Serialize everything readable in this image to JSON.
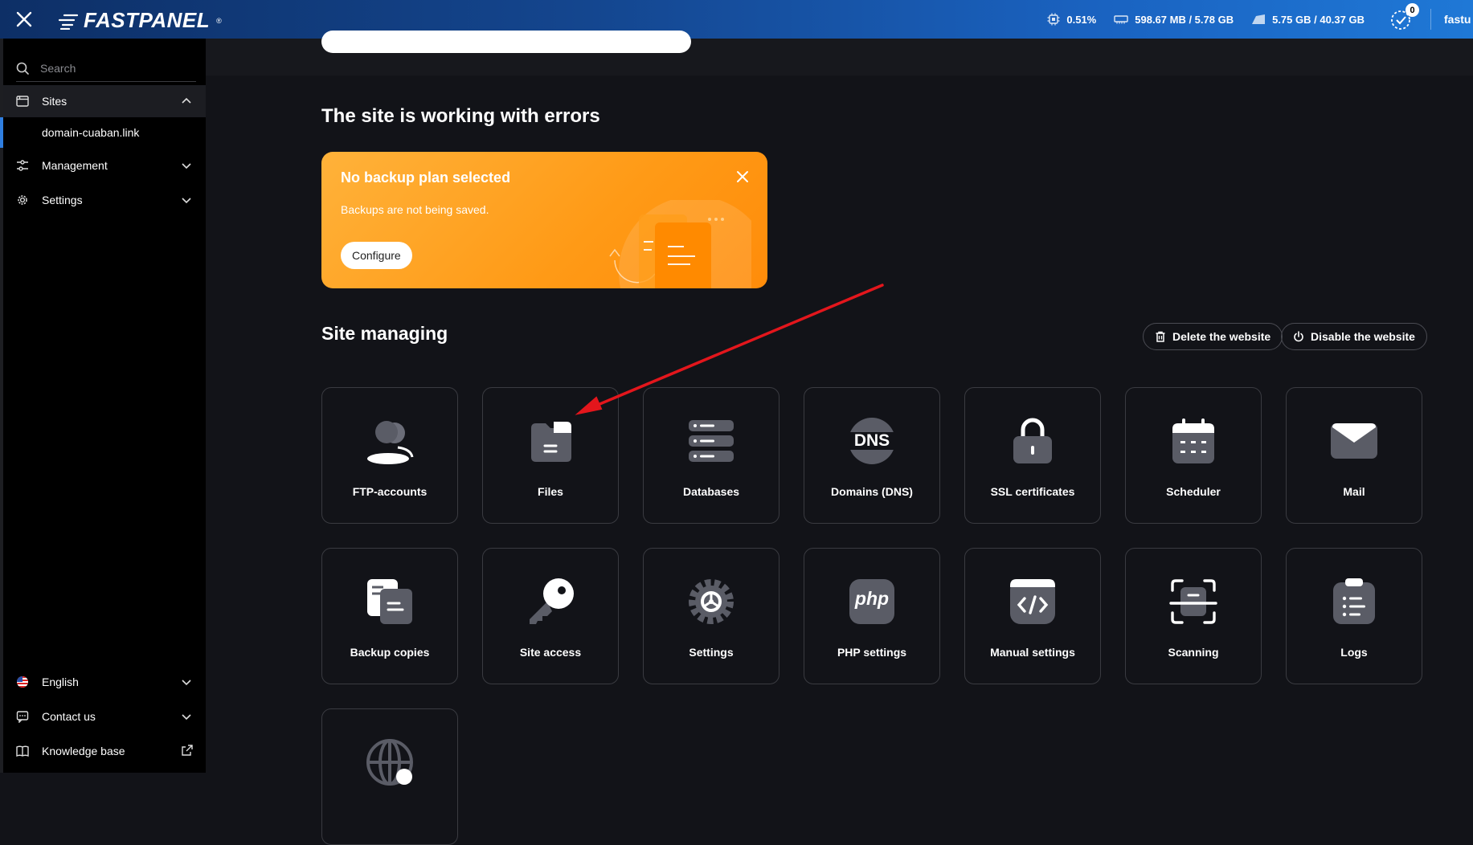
{
  "topbar": {
    "logo": "FASTPANEL",
    "cpu": "0.51%",
    "ram": "598.67 MB / 5.78 GB",
    "disk": "5.75 GB / 40.37 GB",
    "notifications": "0",
    "user": "fastu"
  },
  "sidebar": {
    "search_placeholder": "Search",
    "items": {
      "sites": "Sites",
      "site_domain": "domain-cuaban.link",
      "management": "Management",
      "settings": "Settings",
      "language": "English",
      "contact": "Contact us",
      "knowledge": "Knowledge base"
    }
  },
  "main": {
    "status_title": "The site is working with errors",
    "banner": {
      "title": "No backup plan selected",
      "text": "Backups are not being saved.",
      "button": "Configure"
    },
    "managing_title": "Site managing",
    "delete_button": "Delete the website",
    "disable_button": "Disable the website",
    "tiles": {
      "ftp": "FTP-accounts",
      "files": "Files",
      "databases": "Databases",
      "dns": "Domains (DNS)",
      "ssl": "SSL certificates",
      "scheduler": "Scheduler",
      "mail": "Mail",
      "backup": "Backup copies",
      "site_access": "Site access",
      "settings": "Settings",
      "php": "PHP settings",
      "manual": "Manual settings",
      "scanning": "Scanning",
      "logs": "Logs"
    },
    "icon_text": {
      "dns": "DNS",
      "php": "php"
    }
  }
}
